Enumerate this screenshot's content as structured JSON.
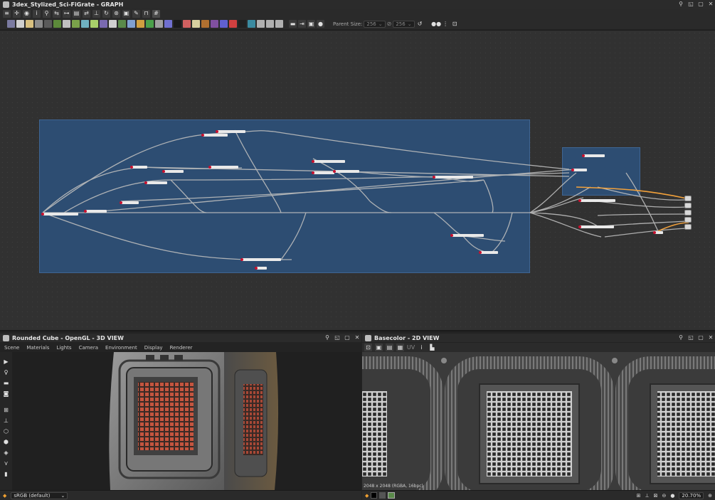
{
  "app": {
    "graph_title": "3dex_Stylized_Sci-FiGrate - GRAPH",
    "view3d_title": "Rounded Cube - OpenGL - 3D VIEW",
    "view2d_title": "Basecolor - 2D VIEW"
  },
  "graph_toolbar": {
    "parent_size_label": "Parent Size:",
    "parent_size_w": "256",
    "parent_size_h": "256"
  },
  "view3d_menu": [
    "Scene",
    "Materials",
    "Lights",
    "Camera",
    "Environment",
    "Display",
    "Renderer"
  ],
  "view3d_status": {
    "colorspace": "sRGB (default)"
  },
  "view2d_status": {
    "image_info": "2048 x 2048 (RGBA, 16bpc)",
    "zoom": "20.70%"
  },
  "colors": {
    "frame_blue": "#2d4d72",
    "wire": "#bfbfbf",
    "wire_highlight": "#f2a13b",
    "node_red": "#c8102e",
    "grate_red": "#c4553f"
  },
  "icons": [
    "graph-icon",
    "select-icon",
    "camera-icon",
    "lightbulb-icon",
    "cube-icon",
    "grid-icon",
    "zoom-icon",
    "info-icon",
    "histogram-icon"
  ]
}
